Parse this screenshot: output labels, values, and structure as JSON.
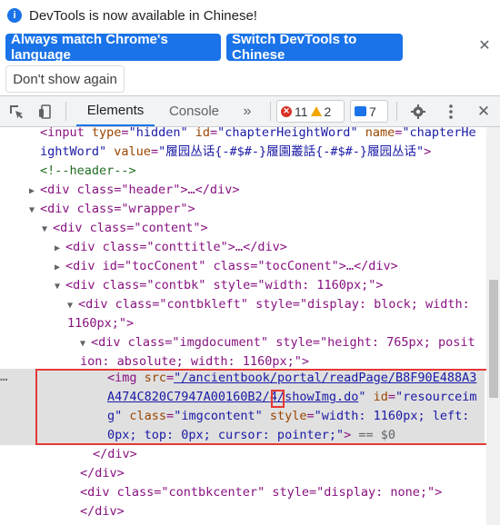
{
  "infobar": {
    "message": "DevTools is now available in Chinese!",
    "match_button": "Always match Chrome's language",
    "switch_button": "Switch DevTools to Chinese",
    "dismiss_button": "Don't show again",
    "close_symbol": "✕"
  },
  "toolbar": {
    "tabs": [
      "Elements",
      "Console"
    ],
    "more_symbol": "»",
    "error_count": "11",
    "warning_count": "2",
    "message_count": "7"
  },
  "code": {
    "l1a": "<input ",
    "l1_type_attr": "type",
    "l1_type_val": "\"hidden\"",
    "l1_id_attr": "id",
    "l1_id_val": "\"chapterHeightWord\"",
    "l1_name_attr": "name",
    "l1_name_val": "\"chapterHe",
    "l2_cont": "ightWord\"",
    "l2_value_attr": "value",
    "l2_value_val": "\"履园丛话{-#$#-}履園叢話{-#$#-}履园丛话\"",
    "l2_close": ">",
    "comment": "<!--header-->",
    "header_line": "<div class=\"header\">…</div>",
    "wrapper_line": "<div class=\"wrapper\">",
    "content_line": "<div class=\"content\">",
    "conttitle_line": "<div class=\"conttitle\">…</div>",
    "toc_line": "<div id=\"tocConent\" class=\"tocConent\">…</div>",
    "contbk_line": "<div class=\"contbk\" style=\"width: 1160px;\">",
    "contbkleft_line1": "<div class=\"contbkleft\" style=\"display: block; width:",
    "contbkleft_line2": "1160px;\">",
    "imgdoc_line1": "<div class=\"imgdocument\" style=\"height: 765px; posit",
    "imgdoc_line2": "ion: absolute; width: 1160px;\">",
    "img_tag": "<img ",
    "img_src_attr": "src",
    "img_src_val_1": "\"/ancientbook/portal/readPage/B8F90E488A3",
    "img_src_val_2a": "A474C820C7947A00160B2/",
    "img_src_val_2b": "4",
    "img_src_val_2c": "/showImg.do",
    "img_src_q": "\"",
    "img_id_attr": "id",
    "img_id_val": "\"resourceim",
    "img_l3_cont": "g\"",
    "img_class_attr": "class",
    "img_class_val": "\"imgcontent\"",
    "img_style_attr": "style",
    "img_style_val_1": "\"width: 1160px; left:",
    "img_style_val_2": "0px; top: 0px; cursor: pointer;\"",
    "img_close": ">",
    "img_dollar": " == $0",
    "close_div_1": "</div>",
    "close_div_2": "</div>",
    "contbkcenter_line": "<div class=\"contbkcenter\" style=\"display: none;\">",
    "close_div_3": "</div>",
    "ellipsis": "…"
  }
}
